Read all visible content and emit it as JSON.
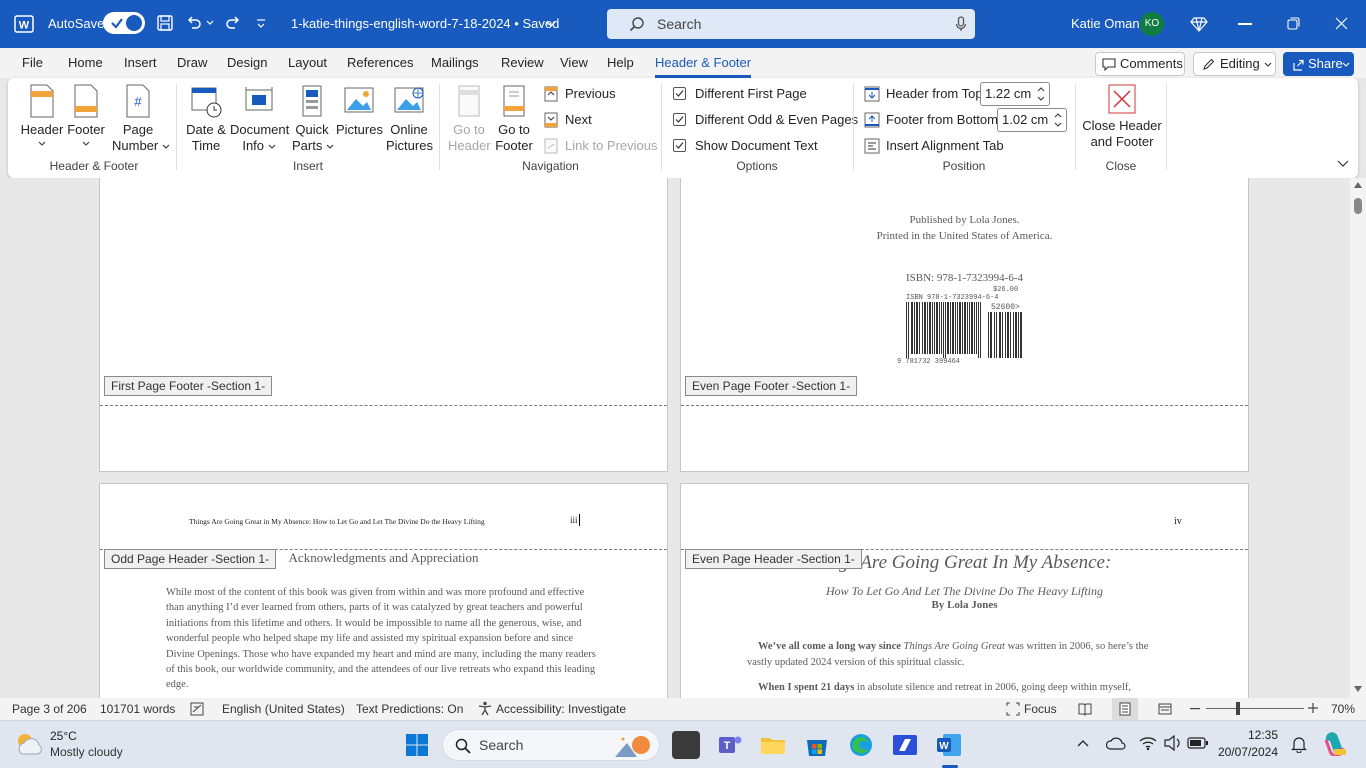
{
  "titlebar": {
    "autosave_label": "AutoSave",
    "doc_title": "1-katie-things-english-word-7-18-2024 • Saved",
    "search_placeholder": "Search",
    "user_name": "Katie Oman",
    "user_initials": "KO",
    "accent": "#185abd"
  },
  "menu": {
    "tabs": [
      "File",
      "Home",
      "Insert",
      "Draw",
      "Design",
      "Layout",
      "References",
      "Mailings",
      "Review",
      "View",
      "Help",
      "Header & Footer"
    ],
    "active_tab": "Header & Footer",
    "comments_label": "Comments",
    "editing_label": "Editing",
    "share_label": "Share"
  },
  "ribbon": {
    "groups": {
      "header_footer": "Header & Footer",
      "insert": "Insert",
      "navigation": "Navigation",
      "options": "Options",
      "position": "Position",
      "close": "Close"
    },
    "header": "Header",
    "footer": "Footer",
    "page_number_1": "Page",
    "page_number_2": "Number",
    "date_time_1": "Date &",
    "date_time_2": "Time",
    "document_info_1": "Document",
    "document_info_2": "Info",
    "quick_parts_1": "Quick",
    "quick_parts_2": "Parts",
    "pictures": "Pictures",
    "online_pictures_1": "Online",
    "online_pictures_2": "Pictures",
    "go_to_header_1": "Go to",
    "go_to_header_2": "Header",
    "go_to_footer_1": "Go to",
    "go_to_footer_2": "Footer",
    "previous": "Previous",
    "next": "Next",
    "link_to_previous": "Link to Previous",
    "different_first_page": "Different First Page",
    "different_odd_even": "Different Odd & Even Pages",
    "show_document_text": "Show Document Text",
    "header_from_top_label": "Header from Top:",
    "header_from_top_value": "1.22 cm",
    "footer_from_bottom_label": "Footer from Bottom:",
    "footer_from_bottom_value": "1.02 cm",
    "insert_alignment_tab": "Insert Alignment Tab",
    "close_1": "Close Header",
    "close_2": "and Footer"
  },
  "document": {
    "page_tr": {
      "publisher": "Published by Lola Jones.",
      "printed": "Printed in the United States of America.",
      "isbn": "ISBN: 978-1-7323994-6-4",
      "barcode_price": "$26.00",
      "barcode_isbn": "ISBN 978-1-7323994-6-4",
      "barcode_supp": "52600>",
      "barcode_number": "9 781732 399464"
    },
    "first_page_footer_label": "First Page Footer -Section 1-",
    "even_page_footer_label": "Even Page Footer -Section 1-",
    "odd_page_header_label": "Odd Page Header -Section 1-",
    "even_page_header_label": "Even Page Header -Section 1-",
    "page_bl": {
      "running_header": "Things Are Going Great in My Absence: How to Let Go and Let The Divine Do the Heavy Lifting",
      "page_num": "iii",
      "heading": "Acknowledgments and Appreciation",
      "body": "While most of the content of this book was given from within and was more profound and effective than anything I’d ever learned from others, parts of it was catalyzed by great teachers and powerful initiations from this lifetime and others. It would be impossible to name all the generous, wise, and wonderful people who helped shape my life and assisted my spiritual expansion before and since Divine Openings. Those who have expanded my heart and mind are many, including the many readers of this book, our worldwide community, and the attendees of our live retreats who expand this leading edge."
    },
    "page_br": {
      "page_num": "iv",
      "title": "gs Are Going Great In My Absence:",
      "subtitle": "How To Let Go And Let The Divine Do The Heavy Lifting",
      "byline": "By Lola Jones",
      "p1_bold": "We’ve all come a long way since ",
      "p1_italic": "Things Are Going Great",
      "p1_rest": " was written in 2006, so here’s the",
      "p1_line2": "vastly updated 2024 version of this spiritual classic.",
      "p2_bold": "When I spent 21 days",
      "p2_rest": " in absolute silence and retreat in 2006, going deep within myself,"
    }
  },
  "statusbar": {
    "page": "Page 3 of 206",
    "words": "101701 words",
    "language": "English (United States)",
    "text_predictions": "Text Predictions: On",
    "accessibility": "Accessibility: Investigate",
    "focus": "Focus",
    "zoom": "70%"
  },
  "taskbar": {
    "temp": "25°C",
    "weather": "Mostly cloudy",
    "search": "Search",
    "time": "12:35",
    "date": "20/07/2024"
  }
}
